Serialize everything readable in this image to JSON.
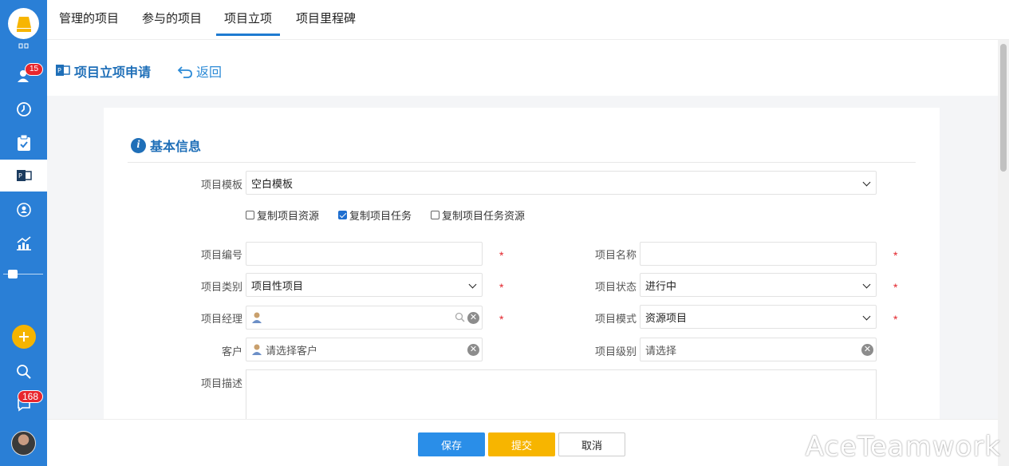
{
  "rail": {
    "notify_badge": "15",
    "chat_badge": "168"
  },
  "tabs": [
    {
      "label": "管理的项目"
    },
    {
      "label": "参与的项目"
    },
    {
      "label": "项目立项"
    },
    {
      "label": "项目里程碑"
    }
  ],
  "header": {
    "title": "项目立项申请",
    "back_label": "返回"
  },
  "section": {
    "title": "基本信息"
  },
  "form": {
    "template_label": "项目模板",
    "template_value": "空白模板",
    "copy_resources": {
      "label": "复制项目资源",
      "checked": false
    },
    "copy_tasks": {
      "label": "复制项目任务",
      "checked": true
    },
    "copy_task_resources": {
      "label": "复制项目任务资源",
      "checked": false
    },
    "code_label": "项目编号",
    "code_value": "",
    "name_label": "项目名称",
    "name_value": "",
    "category_label": "项目类别",
    "category_value": "项目性项目",
    "status_label": "项目状态",
    "status_value": "进行中",
    "manager_label": "项目经理",
    "manager_value": "",
    "mode_label": "项目模式",
    "mode_value": "资源项目",
    "customer_label": "客户",
    "customer_placeholder": "请选择客户",
    "level_label": "项目级别",
    "level_placeholder": "请选择",
    "desc_label": "项目描述",
    "required_mark": "*"
  },
  "footer": {
    "save": "保存",
    "submit": "提交",
    "cancel": "取消"
  },
  "watermark": "AceTeamwork",
  "colors": {
    "rail": "#2a7fd6",
    "accent": "#1f6fb8",
    "save": "#2a8ee8",
    "submit": "#f7b500",
    "required": "#e3242b"
  }
}
